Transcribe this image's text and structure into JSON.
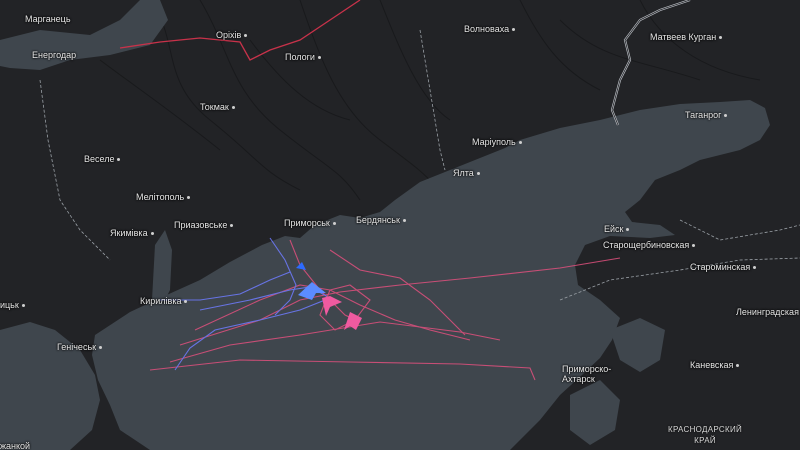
{
  "map": {
    "colors": {
      "land": "#222326",
      "sea": "#3f464d",
      "border": "#9aa0a6",
      "border_red": "#c8324a",
      "track_pink": "#e0507e",
      "track_blue": "#6f7cff",
      "aircraft_blue": "#5b8cff",
      "aircraft_pink": "#f05aa0"
    },
    "places": [
      {
        "id": "marhanets",
        "name": "Марганець"
      },
      {
        "id": "enerhodar",
        "name": "Енергодар"
      },
      {
        "id": "orikhiv",
        "name": "Оріхів"
      },
      {
        "id": "polohy",
        "name": "Пологи"
      },
      {
        "id": "volnovakha",
        "name": "Волноваха"
      },
      {
        "id": "matveev-kurgan",
        "name": "Матвеев Курган"
      },
      {
        "id": "tokmak",
        "name": "Токмак"
      },
      {
        "id": "vesele",
        "name": "Веселе"
      },
      {
        "id": "melitopol",
        "name": "Мелітополь"
      },
      {
        "id": "mariupol",
        "name": "Маріуполь"
      },
      {
        "id": "taganrog",
        "name": "Таганрог"
      },
      {
        "id": "yalta",
        "name": "Ялта"
      },
      {
        "id": "yakymivka",
        "name": "Якимівка"
      },
      {
        "id": "pryazovske",
        "name": "Приазовське"
      },
      {
        "id": "prymorsk",
        "name": "Приморськ"
      },
      {
        "id": "berdiansk",
        "name": "Бердянськ"
      },
      {
        "id": "yeysk",
        "name": "Ейск"
      },
      {
        "id": "starosherb",
        "name": "Старощербиновская"
      },
      {
        "id": "staromin",
        "name": "Староминская"
      },
      {
        "id": "kyrylivka",
        "name": "Кирилівка"
      },
      {
        "id": "henichesk",
        "name": "Генічеськ"
      },
      {
        "id": "leningradskaya",
        "name": "Ленинградская"
      },
      {
        "id": "kanevskaya",
        "name": "Каневская"
      },
      {
        "id": "primorsko-akhtarsk",
        "name": "Приморско-Ахтарск"
      },
      {
        "id": "ytsk",
        "name": "ицьк"
      },
      {
        "id": "dzhankoi",
        "name": "жанкой"
      }
    ],
    "region_label": {
      "line1": "КРАСНОДАРСКИЙ",
      "line2": "КРАЙ"
    }
  }
}
